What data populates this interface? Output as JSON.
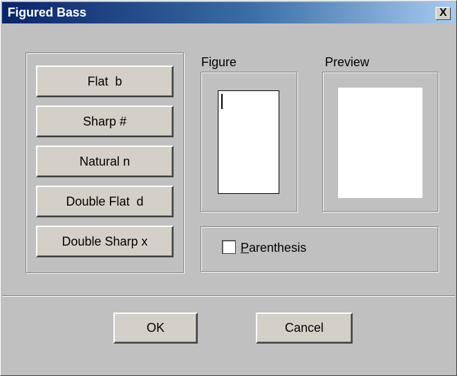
{
  "window": {
    "title": "Figured Bass",
    "close_glyph": "X"
  },
  "accidentals": [
    {
      "label": "Flat  b"
    },
    {
      "label": "Sharp #"
    },
    {
      "label": "Natural n"
    },
    {
      "label": "Double Flat  d"
    },
    {
      "label": "Double Sharp x"
    }
  ],
  "figure": {
    "label": "Figure",
    "value": ""
  },
  "preview": {
    "label": "Preview"
  },
  "parenthesis": {
    "label_first": "P",
    "label_rest": "arenthesis",
    "checked": false
  },
  "footer": {
    "ok_label": "OK",
    "cancel_label": "Cancel"
  }
}
